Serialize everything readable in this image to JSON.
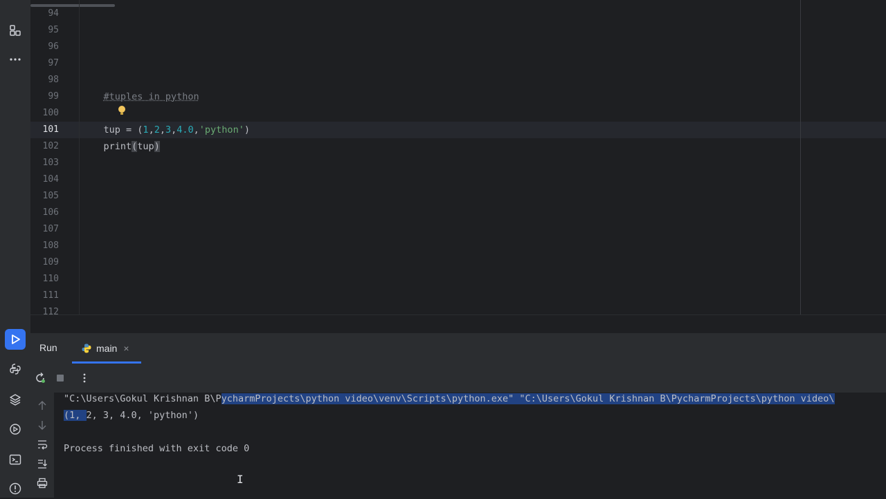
{
  "editor": {
    "line_numbers": [
      "94",
      "95",
      "96",
      "97",
      "98",
      "99",
      "100",
      "101",
      "102",
      "103",
      "104",
      "105",
      "106",
      "107",
      "108",
      "109",
      "110",
      "111",
      "112"
    ],
    "current_line": "101",
    "code": {
      "comment": "#tuples in python",
      "assign_var": "tup",
      "assign_op": " = (",
      "n1": "1",
      "c1": ",",
      "n2": "2",
      "c2": ",",
      "n3": "3",
      "c3": ",",
      "n4": "4.0",
      "c4": ",",
      "s1": "'python'",
      "close": ")",
      "print_fn": "print",
      "print_open": "(",
      "print_arg": "tup",
      "print_close": ")"
    }
  },
  "run_panel": {
    "title": "Run",
    "tab_label": "main",
    "tab_close": "×"
  },
  "console": {
    "cmd_part1": "\"C:\\Users\\Gokul Krishnan B\\P",
    "cmd_part2": "ycharmProjects\\python video\\venv\\Scripts\\python.exe\" \"C:\\Users\\Gokul Krishnan B\\PycharmProjects\\python video\\",
    "out_sel": "(1, ",
    "out_rest": "2, 3, 4.0, 'python')",
    "exit_msg": "Process finished with exit code 0"
  },
  "icons": {
    "left_strip": [
      "project-structure-icon",
      "more-icon",
      "run-icon",
      "python-console-icon",
      "layers-icon",
      "services-icon",
      "terminal-icon",
      "problems-icon"
    ],
    "toolbar": [
      "rerun-icon",
      "stop-icon",
      "more-vertical-icon"
    ],
    "console_side": [
      "scroll-up-icon",
      "scroll-down-icon",
      "soft-wrap-icon",
      "scroll-to-end-icon",
      "print-icon"
    ]
  },
  "colors": {
    "accent": "#3574f0",
    "selection": "#214283"
  }
}
